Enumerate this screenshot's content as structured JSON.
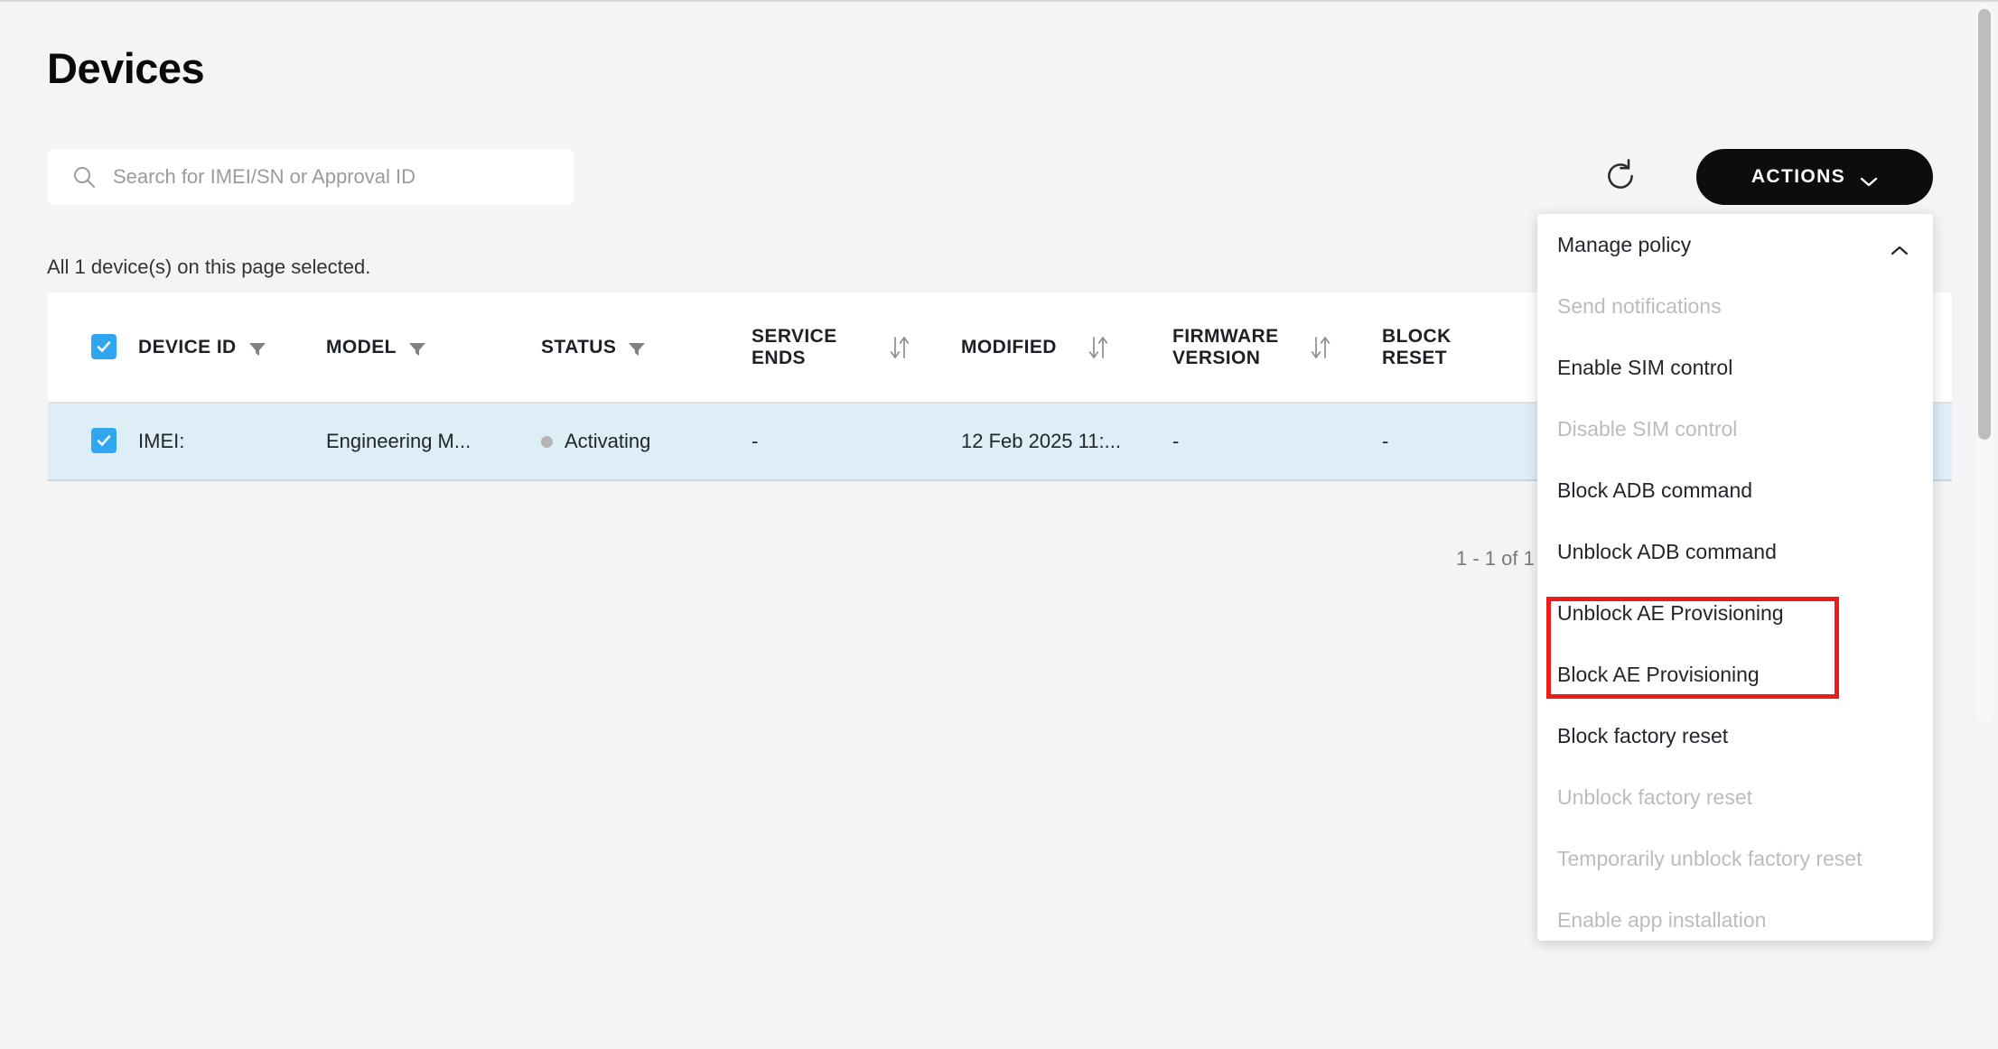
{
  "page": {
    "title": "Devices",
    "selection_note": "All 1 device(s) on this page selected.",
    "pagination": "1 - 1 of 1"
  },
  "search": {
    "placeholder": "Search for IMEI/SN or Approval ID",
    "value": "",
    "icon": "search-icon"
  },
  "toolbar": {
    "refresh_icon": "refresh-icon",
    "actions_label": "ACTIONS",
    "actions_caret_icon": "chevron-down-icon"
  },
  "table": {
    "select_all_checked": true,
    "columns": [
      {
        "label": "DEVICE ID",
        "filter": true,
        "sort": false
      },
      {
        "label": "MODEL",
        "filter": true,
        "sort": false
      },
      {
        "label": "STATUS",
        "filter": true,
        "sort": false
      },
      {
        "label": "SERVICE ENDS",
        "filter": false,
        "sort": true
      },
      {
        "label": "MODIFIED",
        "filter": false,
        "sort": true
      },
      {
        "label": "FIRMWARE VERSION",
        "filter": false,
        "sort": true
      },
      {
        "label": "BLOCK RESET",
        "filter": false,
        "sort": false
      }
    ],
    "rows": [
      {
        "checked": true,
        "device_id": "IMEI:",
        "model": "Engineering M...",
        "status": "Activating",
        "status_dot_color": "#b5b5b5",
        "service_ends": "-",
        "modified": "12 Feb 2025 11:...",
        "firmware_version": "-",
        "block_reset": "-"
      }
    ]
  },
  "actions_menu": {
    "items": [
      {
        "label": "Manage policy",
        "disabled": false,
        "caret": "chevron-up-icon"
      },
      {
        "label": "Send notifications",
        "disabled": true
      },
      {
        "label": "Enable SIM control",
        "disabled": false
      },
      {
        "label": "Disable SIM control",
        "disabled": true
      },
      {
        "label": "Block ADB command",
        "disabled": false
      },
      {
        "label": "Unblock ADB command",
        "disabled": false
      },
      {
        "label": "Unblock AE Provisioning",
        "disabled": false
      },
      {
        "label": "Block AE Provisioning",
        "disabled": false
      },
      {
        "label": "Block factory reset",
        "disabled": false
      },
      {
        "label": "Unblock factory reset",
        "disabled": true
      },
      {
        "label": "Temporarily unblock factory reset",
        "disabled": true
      },
      {
        "label": "Enable app installation",
        "disabled": true
      }
    ]
  },
  "annotation": {
    "color": "#ee1b1b"
  },
  "colors": {
    "page_background": "#f4f4f4",
    "surface": "#ffffff",
    "accent_checkbox": "#2ea6f0",
    "row_selected": "#deeef7",
    "actions_button": "#0d0d0d"
  }
}
